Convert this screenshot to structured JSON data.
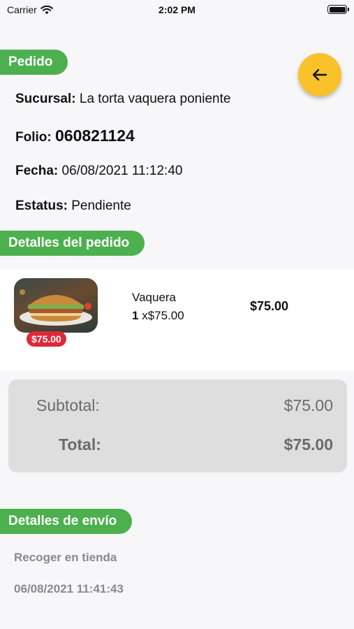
{
  "status_bar": {
    "carrier": "Carrier",
    "time": "2:02 PM"
  },
  "order": {
    "section_title": "Pedido",
    "sucursal_label": "Sucursal:",
    "sucursal_value": "La torta vaquera poniente",
    "folio_label": "Folio:",
    "folio_value": "060821124",
    "fecha_label": "Fecha:",
    "fecha_value": "06/08/2021 11:12:40",
    "estatus_label": "Estatus:",
    "estatus_value": "Pendiente"
  },
  "back_button": {
    "icon": "arrow-left-icon"
  },
  "details": {
    "section_title": "Detalles del pedido",
    "items": [
      {
        "name": "Vaquera",
        "qty": "1",
        "unit_price": "x$75.00",
        "badge_price": "$75.00",
        "line_total": "$75.00"
      }
    ]
  },
  "totals": {
    "subtotal_label": "Subtotal:",
    "subtotal_value": "$75.00",
    "total_label": "Total:",
    "total_value": "$75.00"
  },
  "shipping": {
    "section_title": "Detalles de envío",
    "method": "Recoger en tienda",
    "datetime": "06/08/2021 11:41:43"
  },
  "colors": {
    "accent_green": "#4cb04f",
    "back_button": "#f9c22a",
    "badge_red": "#e0283a"
  }
}
